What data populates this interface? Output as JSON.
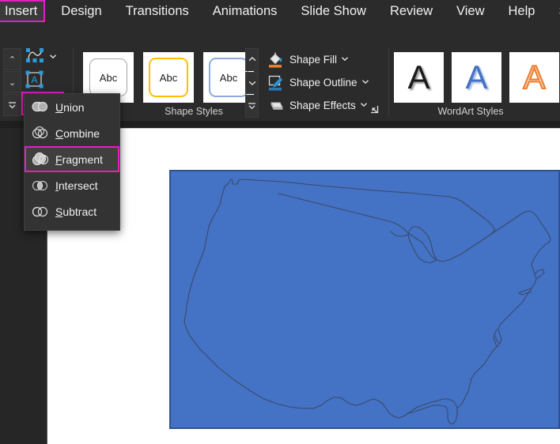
{
  "app": {
    "name": "PowerPoint",
    "accent_magenta": "#e020c0",
    "ribbon_bg": "#2b2b2b",
    "shape_fill_blue": "#4472c4",
    "shape_outline_blue": "#2f528f"
  },
  "tabbar": {
    "tabs": [
      {
        "label": "Insert",
        "state": "highlighted"
      },
      {
        "label": "Design",
        "state": "normal"
      },
      {
        "label": "Transitions",
        "state": "normal"
      },
      {
        "label": "Animations",
        "state": "normal"
      },
      {
        "label": "Slide Show",
        "state": "normal"
      },
      {
        "label": "Review",
        "state": "normal"
      },
      {
        "label": "View",
        "state": "normal"
      },
      {
        "label": "Help",
        "state": "normal"
      },
      {
        "label": "Sh",
        "state": "active-clipped"
      }
    ]
  },
  "ribbon": {
    "clipped_char": "s",
    "gallery_scroll": {
      "up": "⌃",
      "down": "⌄",
      "more": "⌄"
    },
    "insert_shapes_tools": [
      {
        "name": "edit-shape",
        "has_chevron": true
      },
      {
        "name": "text-box",
        "has_chevron": false
      },
      {
        "name": "merge-shapes",
        "has_chevron": true,
        "state": "highlighted"
      }
    ],
    "shape_styles": {
      "group_label": "Shape Styles",
      "thumbs": [
        {
          "text": "Abc",
          "outline": "#a6a6a6",
          "fill": "#ffffff"
        },
        {
          "text": "Abc",
          "outline": "#ffc000",
          "fill": "#ffffff"
        },
        {
          "text": "Abc",
          "outline": "#8eaadb",
          "fill": "#ffffff"
        }
      ],
      "nav": {
        "up": "⌃",
        "down": "⌄",
        "more": "⌄"
      },
      "dialog_launcher": "dialog-box-launcher"
    },
    "shape_commands": [
      {
        "label": "Shape Fill",
        "icon": "paint-bucket-icon",
        "bar_color": "#ed7d31",
        "chevron": "⌄"
      },
      {
        "label": "Shape Outline",
        "icon": "pencil-outline-icon",
        "bar_color": "#2e75b6",
        "chevron": "⌄"
      },
      {
        "label": "Shape Effects",
        "icon": "shape-effects-icon",
        "bar_color": "",
        "chevron": "⌄"
      }
    ],
    "wordart_styles": {
      "group_label": "WordArt Styles",
      "thumbs": [
        {
          "text": "A",
          "color": "#1a1a1a",
          "style": "shadow"
        },
        {
          "text": "A",
          "color": "#4472c4",
          "style": "shadow"
        },
        {
          "text": "A",
          "color": "#ed7d31",
          "style": "outline"
        }
      ]
    }
  },
  "merge_menu": {
    "items": [
      {
        "label": "Union",
        "accesskey": "U",
        "icon": "merge-union-icon",
        "state": "normal"
      },
      {
        "label": "Combine",
        "accesskey": "C",
        "icon": "merge-combine-icon",
        "state": "normal"
      },
      {
        "label": "Fragment",
        "accesskey": "F",
        "icon": "merge-fragment-icon",
        "state": "highlighted"
      },
      {
        "label": "Intersect",
        "accesskey": "I",
        "icon": "merge-intersect-icon",
        "state": "normal"
      },
      {
        "label": "Subtract",
        "accesskey": "S",
        "icon": "merge-subtract-icon",
        "state": "normal"
      }
    ]
  },
  "slide": {
    "shape": {
      "name": "usa-map-shape",
      "fill": "#4472c4",
      "outline": "#2f528f",
      "map_line": "#3a4a6b"
    }
  }
}
